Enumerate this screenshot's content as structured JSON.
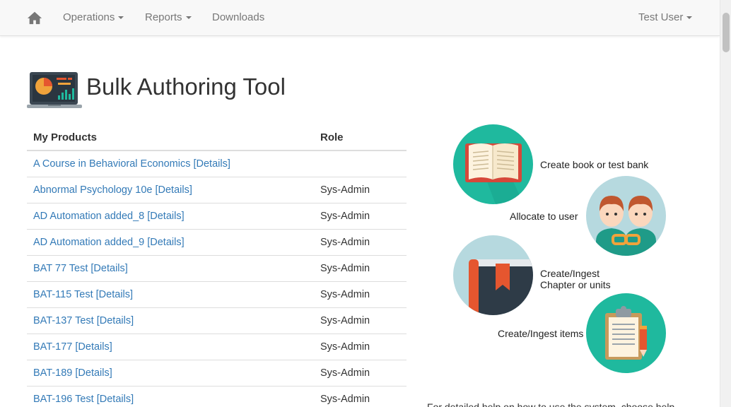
{
  "navbar": {
    "home_icon": "home-icon",
    "operations_label": "Operations",
    "reports_label": "Reports",
    "downloads_label": "Downloads",
    "user_label": "Test User"
  },
  "header": {
    "title": "Bulk Authoring Tool",
    "logo_icon": "laptop-chart-icon"
  },
  "products_table": {
    "columns": [
      "My Products",
      "Role"
    ],
    "rows": [
      {
        "product": "A Course in Behavioral Economics [Details]",
        "role": ""
      },
      {
        "product": "Abnormal Psychology 10e [Details]",
        "role": "Sys-Admin"
      },
      {
        "product": "AD Automation added_8 [Details]",
        "role": "Sys-Admin"
      },
      {
        "product": "AD Automation added_9 [Details]",
        "role": "Sys-Admin"
      },
      {
        "product": "BAT 77 Test [Details]",
        "role": "Sys-Admin"
      },
      {
        "product": "BAT-115 Test [Details]",
        "role": "Sys-Admin"
      },
      {
        "product": "BAT-137 Test [Details]",
        "role": "Sys-Admin"
      },
      {
        "product": "BAT-177 [Details]",
        "role": "Sys-Admin"
      },
      {
        "product": "BAT-189 [Details]",
        "role": "Sys-Admin"
      },
      {
        "product": "BAT-196 Test [Details]",
        "role": "Sys-Admin"
      }
    ]
  },
  "infographic": {
    "steps": [
      {
        "label": "Create book or test bank",
        "icon": "book-icon"
      },
      {
        "label": "Allocate to user",
        "icon": "users-icon"
      },
      {
        "label_line1": "Create/Ingest",
        "label_line2": "Chapter or units",
        "icon": "bookmark-book-icon"
      },
      {
        "label": "Create/Ingest items",
        "icon": "clipboard-icon"
      }
    ]
  },
  "help": {
    "text": "For detailed help on how to use the system, choose help"
  },
  "colors": {
    "link": "#337ab7",
    "teal": "#1fb99e",
    "light_blue": "#b6d9df"
  }
}
